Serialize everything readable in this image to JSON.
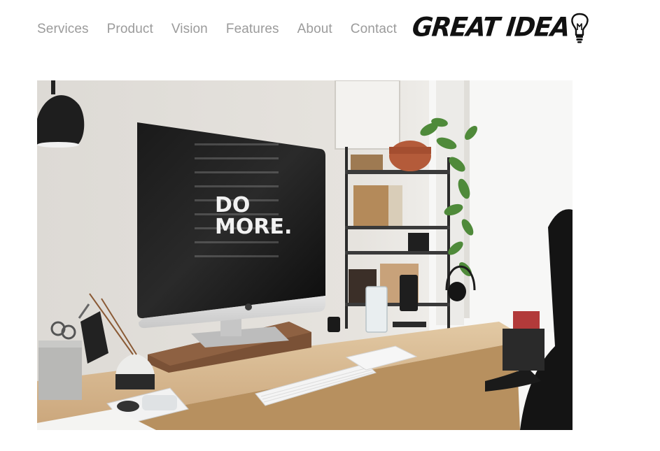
{
  "nav": {
    "items": [
      {
        "label": "Services"
      },
      {
        "label": "Product"
      },
      {
        "label": "Vision"
      },
      {
        "label": "Features"
      },
      {
        "label": "About"
      },
      {
        "label": "Contact"
      }
    ]
  },
  "logo": {
    "text": "GREAT IDEA",
    "icon": "lightbulb-icon"
  },
  "hero": {
    "screen_text_line1": "DO",
    "screen_text_line2": "MORE."
  },
  "colors": {
    "nav_text": "#9b9b9b",
    "logo_text": "#111111",
    "background": "#ffffff"
  }
}
